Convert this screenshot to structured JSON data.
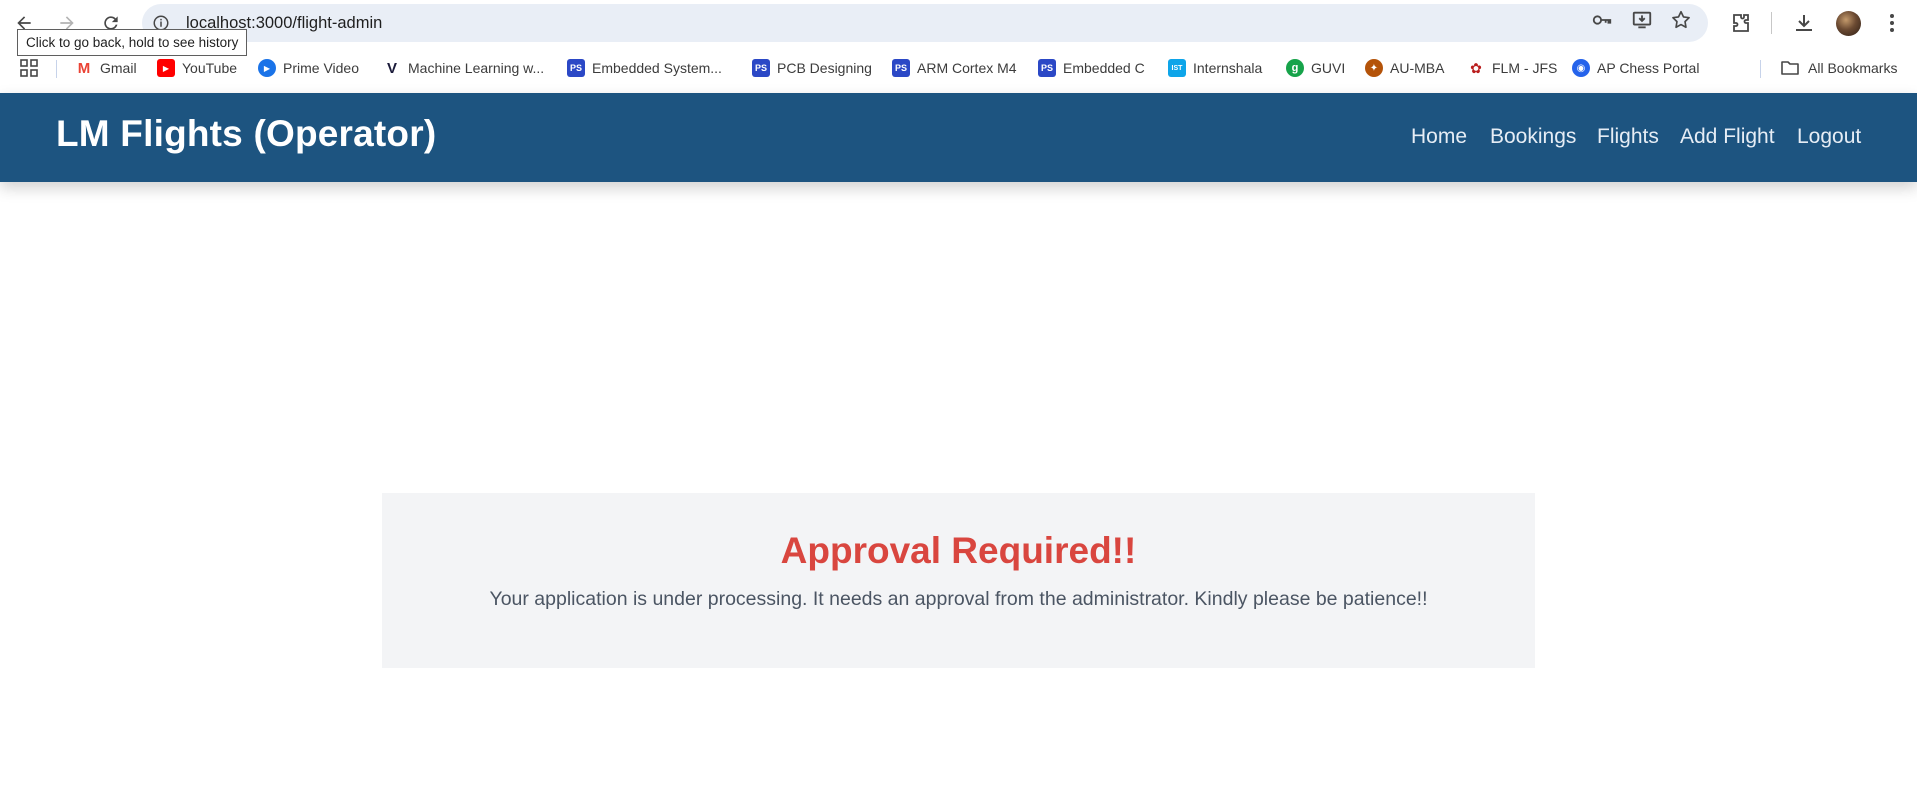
{
  "browser": {
    "url": "localhost:3000/flight-admin",
    "tooltip": "Click to go back, hold to see history",
    "bookmarks": [
      {
        "label": "Gmail",
        "icon": "gmail-icon",
        "color": "#ea4335",
        "glyph": "M"
      },
      {
        "label": "YouTube",
        "icon": "youtube-icon",
        "color": "#ff0000",
        "glyph": "▶"
      },
      {
        "label": "Prime Video",
        "icon": "prime-video-icon",
        "color": "#1a73e8",
        "glyph": "▶"
      },
      {
        "label": "Machine Learning w...",
        "icon": "ml-bookmark-icon",
        "color": "#1b1b3a",
        "glyph": "V"
      },
      {
        "label": "Embedded System...",
        "icon": "embedded-system-icon",
        "color": "#2b48c6",
        "glyph": "PS"
      },
      {
        "label": "PCB Designing",
        "icon": "pcb-designing-icon",
        "color": "#2b48c6",
        "glyph": "PS"
      },
      {
        "label": "ARM Cortex M4",
        "icon": "arm-cortex-icon",
        "color": "#2b48c6",
        "glyph": "PS"
      },
      {
        "label": "Embedded C",
        "icon": "embedded-c-icon",
        "color": "#2b48c6",
        "glyph": "PS"
      },
      {
        "label": "Internshala",
        "icon": "internshala-icon",
        "color": "#0ea5e9",
        "glyph": "IST"
      },
      {
        "label": "GUVI",
        "icon": "guvi-icon",
        "color": "#16a34a",
        "glyph": "g"
      },
      {
        "label": "AU-MBA",
        "icon": "au-mba-icon",
        "color": "#b45309",
        "glyph": "✦"
      },
      {
        "label": "FLM - JFS",
        "icon": "flm-jfs-icon",
        "color": "#6b7280",
        "glyph": "✿"
      },
      {
        "label": "AP Chess Portal",
        "icon": "ap-chess-icon",
        "color": "#2563eb",
        "glyph": "◉"
      }
    ],
    "all_bookmarks": "All Bookmarks"
  },
  "app": {
    "brand": "LM Flights (Operator)",
    "nav": [
      "Home",
      "Bookings",
      "Flights",
      "Add Flight",
      "Logout"
    ],
    "accent_color": "#1d5480"
  },
  "notice": {
    "title": "Approval Required!!",
    "message": "Your application is under processing. It needs an approval from the administrator. Kindly please be patience!!",
    "title_color": "#d9463f"
  }
}
